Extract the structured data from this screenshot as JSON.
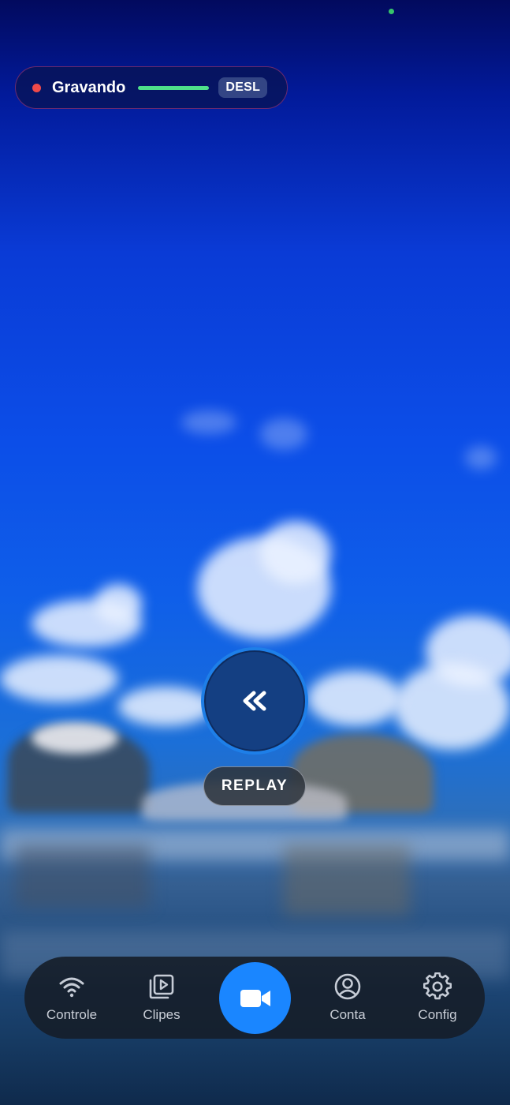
{
  "status": {
    "recording_label": "Gravando",
    "mode_badge": "DESL"
  },
  "replay": {
    "label": "REPLAY"
  },
  "nav": {
    "items": [
      {
        "label": "Controle",
        "icon": "wifi-icon"
      },
      {
        "label": "Clipes",
        "icon": "clips-icon"
      },
      {
        "label": "",
        "icon": "video-camera-icon"
      },
      {
        "label": "Conta",
        "icon": "account-icon"
      },
      {
        "label": "Config",
        "icon": "gear-icon"
      }
    ]
  },
  "colors": {
    "accent": "#1a86ff",
    "recording_dot": "#ef4a4a",
    "recording_bar": "#4fe08a",
    "status_dot": "#37c46b"
  }
}
